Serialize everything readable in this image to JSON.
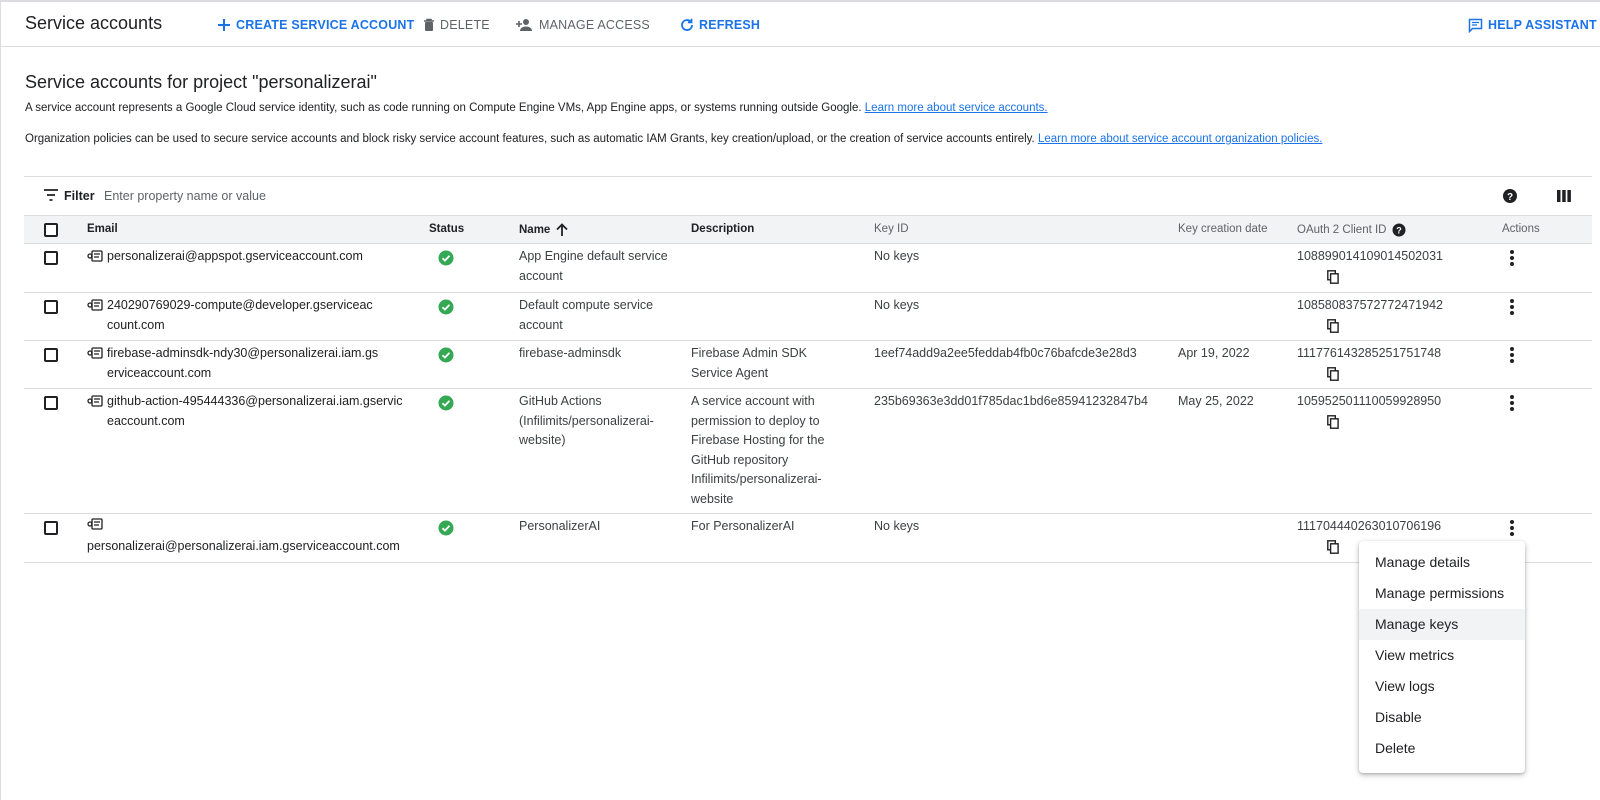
{
  "header": {
    "title": "Service accounts",
    "create_label": "CREATE SERVICE ACCOUNT",
    "delete_label": "DELETE",
    "manage_access_label": "MANAGE ACCESS",
    "refresh_label": "REFRESH",
    "help_assistant_label": "HELP ASSISTANT"
  },
  "intro": {
    "heading": "Service accounts for project \"personalizerai\"",
    "para1": "A service account represents a Google Cloud service identity, such as code running on Compute Engine VMs, App Engine apps, or systems running outside Google.",
    "para1_link": "Learn more about service accounts.",
    "para2": "Organization policies can be used to secure service accounts and block risky service account features, such as automatic IAM Grants, key creation/upload, or the creation of service accounts entirely.",
    "para2_link": "Learn more about service account organization policies."
  },
  "filter": {
    "label": "Filter",
    "placeholder": "Enter property name or value"
  },
  "table": {
    "columns": {
      "email": "Email",
      "status": "Status",
      "name": "Name",
      "description": "Description",
      "key_id": "Key ID",
      "key_creation_date": "Key creation date",
      "oauth_client_id": "OAuth 2 Client ID",
      "actions": "Actions"
    },
    "rows": [
      {
        "email": "personalizerai@appspot.gserviceaccount.com",
        "name": "App Engine default service account",
        "description": "",
        "key_id": "No keys",
        "key_creation_date": "",
        "client_id": "108899014109014502031"
      },
      {
        "email": "240290769029-compute@developer.gserviceaccount.com",
        "name": "Default compute service account",
        "description": "",
        "key_id": "No keys",
        "key_creation_date": "",
        "client_id": "108580837572772471942"
      },
      {
        "email": "firebase-adminsdk-ndy30@personalizerai.iam.gserviceaccount.com",
        "name": "firebase-adminsdk",
        "description": "Firebase Admin SDK Service Agent",
        "key_id": "1eef74add9a2ee5feddab4fb0c76bafcde3e28d3",
        "key_creation_date": "Apr 19, 2022",
        "client_id": "111776143285251751748"
      },
      {
        "email": "github-action-495444336@personalizerai.iam.gserviceaccount.com",
        "name": "GitHub Actions (Infilimits/personalizerai-website)",
        "description": "A service account with permission to deploy to Firebase Hosting for the GitHub repository Infilimits/personalizerai-website",
        "key_id": "235b69363e3dd01f785dac1bd6e85941232847b4",
        "key_creation_date": "May 25, 2022",
        "client_id": "105952501110059928950"
      },
      {
        "email": "personalizerai@personalizerai.iam.gserviceaccount.com",
        "name": "PersonalizerAI",
        "description": "For PersonalizerAI",
        "key_id": "No keys",
        "key_creation_date": "",
        "client_id": "111704440263010706196"
      }
    ]
  },
  "menu": {
    "items": [
      "Manage details",
      "Manage permissions",
      "Manage keys",
      "View metrics",
      "View logs",
      "Disable",
      "Delete"
    ]
  },
  "colors": {
    "accent": "#1a73e8",
    "status_ok": "#34a853",
    "text": "#202124",
    "muted": "#5f6368"
  }
}
